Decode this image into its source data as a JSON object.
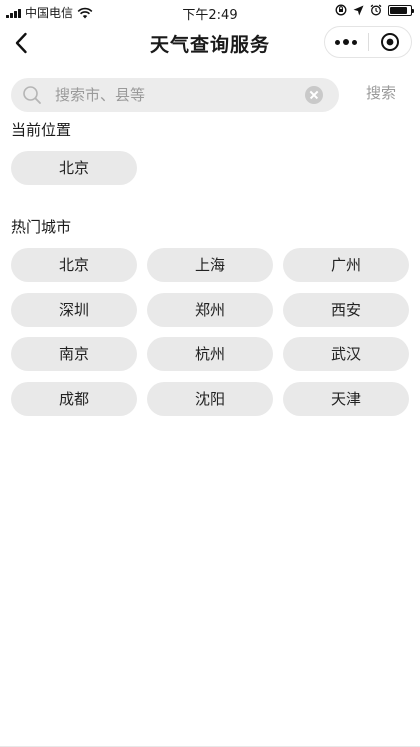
{
  "status_bar": {
    "carrier": "中国电信",
    "time": "下午2:49",
    "battery_level": 0.85,
    "icons": [
      "signal-icon",
      "wifi-icon",
      "lock-rotation-icon",
      "location-arrow-icon",
      "alarm-icon",
      "battery-icon"
    ]
  },
  "nav": {
    "title": "天气查询服务",
    "back_icon": "chevron-left-icon",
    "more_icon": "more-dots-icon",
    "home_icon": "target-circle-icon"
  },
  "search": {
    "placeholder": "搜索市、县等",
    "value": "",
    "button_label": "搜索"
  },
  "current_location": {
    "title": "当前位置",
    "city": "北京"
  },
  "hot_cities": {
    "title": "热门城市",
    "cities": [
      "北京",
      "上海",
      "广州",
      "深圳",
      "郑州",
      "西安",
      "南京",
      "杭州",
      "武汉",
      "成都",
      "沈阳",
      "天津"
    ]
  }
}
